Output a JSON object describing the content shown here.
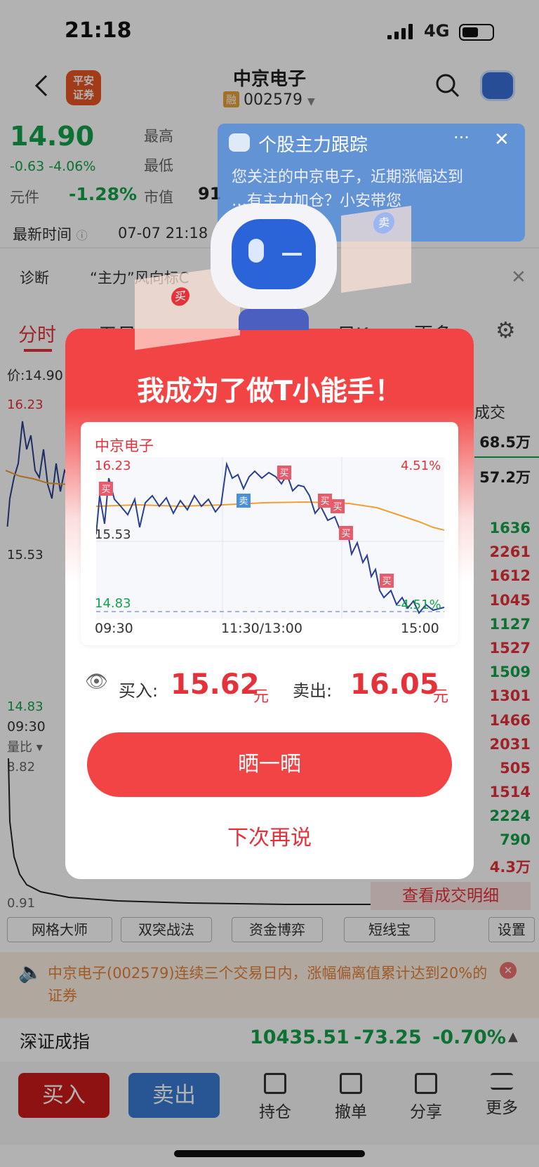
{
  "status_bar": {
    "time": "21:18",
    "network": "4G"
  },
  "header": {
    "stock_name": "中京电子",
    "badge": "融",
    "code": "002579",
    "broker_logo": "平安\n证券"
  },
  "quote": {
    "price": "14.90",
    "change": "-0.63",
    "change_pct": "-4.06%",
    "label_high": "最高",
    "label_low": "最低",
    "label_unit": "元件",
    "unit_pct": "-1.28%",
    "label_mcap": "市值",
    "mcap_partial": "91",
    "label_time": "最新时间",
    "time_value": "07-07 21:18"
  },
  "diagnosis": {
    "label": "诊断",
    "text": "“主力”风向标C"
  },
  "banner": {
    "title": "个股主力跟踪",
    "line1": "您关注的中京电子，近期涨幅达到",
    "line2": "…有主力加仓？小安带您"
  },
  "tabs": {
    "fenshi": "分时",
    "wuri": "五日",
    "rik": "日K",
    "more": "更多"
  },
  "left_chart": {
    "price_label": "价:14.90",
    "high": "16.23",
    "mid": "15.53",
    "low": "14.83",
    "time_start": "09:30",
    "volratio_label": "量比",
    "vol_high": "8.82",
    "vol_low": "0.91"
  },
  "right_column": {
    "header": "成交",
    "vol1": "68.5万",
    "vol2": "57.2万",
    "trades": [
      "1636",
      "2261",
      "1612",
      "1045",
      "1127",
      "1527",
      "1509",
      "1301",
      "1466",
      "2031",
      "505",
      "1514",
      "2224",
      "790",
      "4.3万"
    ],
    "trade_colors": [
      "green",
      "red",
      "red",
      "red",
      "green",
      "red",
      "green",
      "red",
      "red",
      "red",
      "red",
      "red",
      "green",
      "green",
      "red"
    ],
    "detail_link": "查看成交明细"
  },
  "popup": {
    "title": "我成为了做T小能手！",
    "chart_title": "中京电子",
    "y_high": "16.23",
    "y_mid": "15.53",
    "y_low": "14.83",
    "pct_high": "4.51%",
    "pct_low": "-4.51%",
    "x_start": "09:30",
    "x_mid": "11:30/13:00",
    "x_end": "15:00",
    "buy_label": "买入:",
    "buy_price": "15.62",
    "buy_unit": "元",
    "sell_label": "卖出:",
    "sell_price": "16.05",
    "sell_unit": "元",
    "share_button": "晒一晒",
    "later_button": "下次再说",
    "mark_buy": "买",
    "mark_sell": "卖"
  },
  "mascot": {
    "buy_tag": "买",
    "sell_tag": "卖"
  },
  "subtabs": [
    "网格大师",
    "双突战法",
    "资金博弈",
    "短线宝",
    "设置"
  ],
  "notice": {
    "text": "中京电子(002579)连续三个交易日内，涨幅偏离值累计达到20%的证券"
  },
  "index": {
    "name": "深证成指",
    "value": "10435.51",
    "change": "-73.25",
    "pct": "-0.70%"
  },
  "bottom": {
    "buy": "买入",
    "sell": "卖出",
    "hold": "持仓",
    "cancel": "撤单",
    "share": "分享",
    "more": "更多"
  },
  "colors": {
    "red": "#f24444",
    "green": "#13a34a",
    "blue": "#3a7bd5",
    "orange": "#f0a030"
  }
}
